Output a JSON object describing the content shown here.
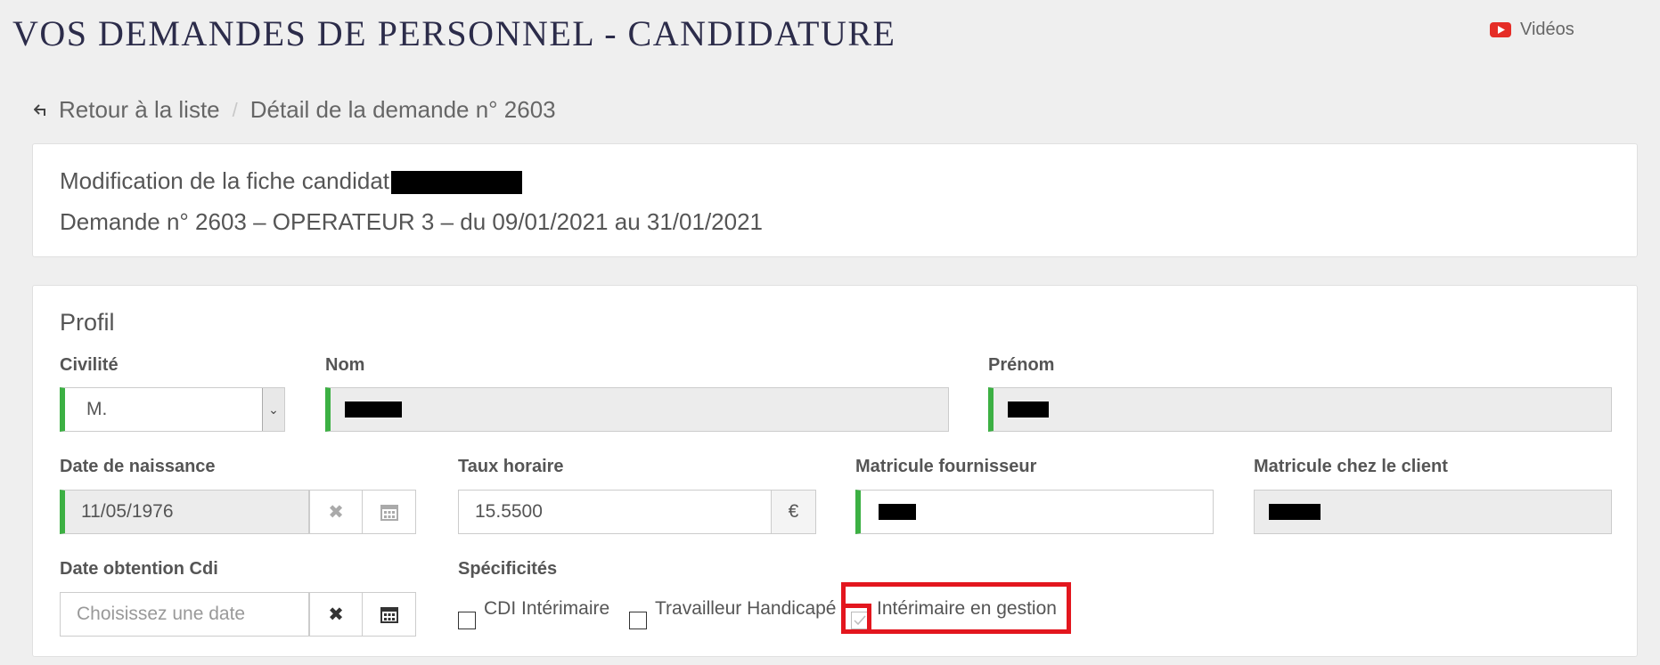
{
  "header": {
    "title": "VOS DEMANDES DE PERSONNEL - CANDIDATURE",
    "videos_label": "Vidéos",
    "videos_icon": "youtube-icon"
  },
  "breadcrumb": {
    "back_label": "Retour à la liste",
    "back_icon": "return-arrow-icon",
    "separator": "/",
    "current": "Détail de la demande n° 2603"
  },
  "summary": {
    "line1": "Modification de la fiche candidat",
    "line2": "Demande n° 2603 – OPERATEUR 3 – du 09/01/2021 au 31/01/2021"
  },
  "profile": {
    "section_title": "Profil",
    "civilite": {
      "label": "Civilité",
      "value": "M."
    },
    "nom": {
      "label": "Nom",
      "value": ""
    },
    "prenom": {
      "label": "Prénom",
      "value": ""
    },
    "date_naissance": {
      "label": "Date de naissance",
      "value": "11/05/1976"
    },
    "taux_horaire": {
      "label": "Taux horaire",
      "value": "15.5500",
      "unit": "€"
    },
    "matricule_fournisseur": {
      "label": "Matricule fournisseur",
      "value": ""
    },
    "matricule_client": {
      "label": "Matricule chez le client",
      "value": ""
    },
    "date_cdi": {
      "label": "Date obtention Cdi",
      "placeholder": "Choisissez une date"
    },
    "specificites": {
      "label": "Spécificités",
      "options": [
        {
          "label": "CDI Intérimaire",
          "checked": false
        },
        {
          "label": "Travailleur Handicapé",
          "checked": false
        },
        {
          "label": "Intérimaire en gestion",
          "checked": true,
          "disabled": true
        }
      ]
    }
  },
  "colors": {
    "required_edge": "#3cb043",
    "highlight": "#e3161e",
    "title": "#2c2c4a"
  }
}
